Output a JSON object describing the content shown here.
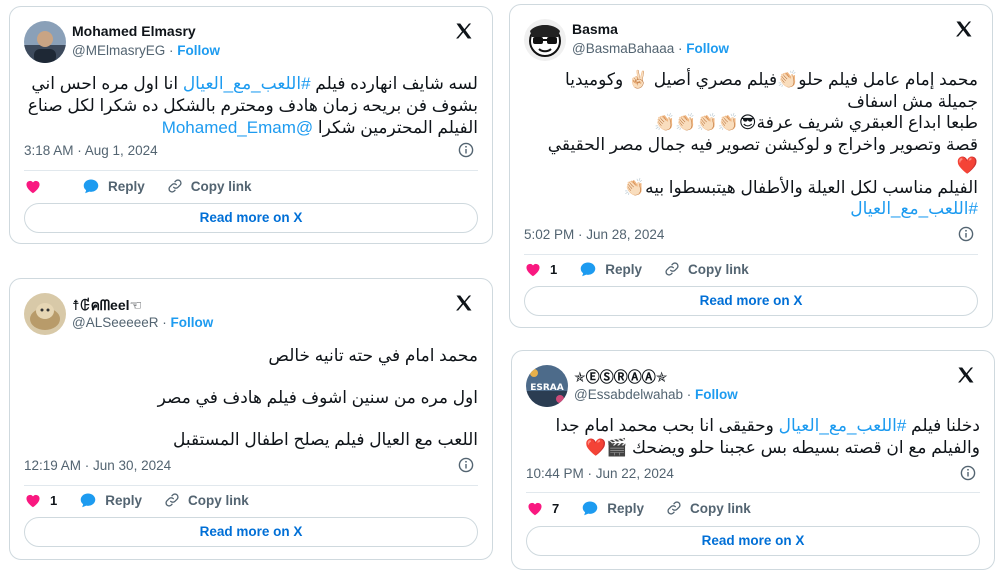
{
  "brand": {
    "blue": "#1d9bf0",
    "heart": "#f91880",
    "text": "#0f1419",
    "muted": "#536471"
  },
  "tweets": [
    {
      "name": "Mohamed Elmasry",
      "handle": "@MElmasryEG",
      "dot": " · ",
      "follow": "Follow",
      "lines": [
        [
          "لسه شايف انهارده فيلم ",
          "#اللعب_مع_العيال",
          " انا اول مره احس اني"
        ],
        [
          "بشوف فن بريحه زمان هادف ومحترم بالشكل ده شكرا لكل صناع"
        ],
        [
          "الفيلم المحترمين شكرا ",
          "@Mohamed_Emam",
          ""
        ]
      ],
      "time": "3:18 AM · Aug 1, 2024",
      "like_count": "",
      "reply": "Reply",
      "copy": "Copy link",
      "readmore": "Read more on X",
      "avatar_icon": "person-photo-icon"
    },
    {
      "name": "Basma",
      "handle": "@BasmaBahaaa",
      "dot": " · ",
      "follow": "Follow",
      "lines": [
        [
          "محمد إمام عامل فيلم حلو👏🏻فيلم مصري أصيل ✌🏻 وكوميديا"
        ],
        [
          "جميلة مش اسفاف"
        ],
        [
          "طبعا ابداع العبقري شريف عرفة😎👏🏻👏🏻👏🏻👏🏻"
        ],
        [
          "قصة وتصوير واخراج و لوكيشن تصوير فيه جمال مصر الحقيقي"
        ],
        [
          "❤️"
        ],
        [
          "الفيلم مناسب لكل العيلة والأطفال هيتبسطوا بيه👏🏻"
        ],
        [
          "",
          "#اللعب_مع_العيال",
          ""
        ]
      ],
      "time": "5:02 PM · Jun 28, 2024",
      "like_count": "1",
      "reply": "Reply",
      "copy": "Copy link",
      "readmore": "Read more on X",
      "avatar_icon": "sunglasses-cartoon-icon"
    },
    {
      "name": "☨ꂅคᗰeel☜",
      "handle": "@ALSeeeeeR",
      "dot": " · ",
      "follow": "Follow",
      "lines": [
        [
          "محمد امام في حته تانيه خالص"
        ],
        [
          "اول مره من سنين اشوف فيلم هادف في مصر"
        ],
        [
          "اللعب مع العيال فيلم يصلح اطفال المستقبل"
        ]
      ],
      "time": "12:19 AM · Jun 30, 2024",
      "like_count": "1",
      "reply": "Reply",
      "copy": "Copy link",
      "readmore": "Read more on X",
      "avatar_icon": "animal-photo-icon"
    },
    {
      "name": "✯ⒺⓈⓇⒶⒶ✯",
      "handle": "@Essabdelwahab",
      "dot": " · ",
      "follow": "Follow",
      "lines": [
        [
          "دخلنا فيلم ",
          "#اللعب_مع_العيال",
          " وحقيقى انا بحب محمد امام جدا"
        ],
        [
          "والفيلم مع ان قصته بسيطه بس عجبنا حلو ويضحك 🎬❤️"
        ]
      ],
      "time": "10:44 PM · Jun 22, 2024",
      "like_count": "7",
      "reply": "Reply",
      "copy": "Copy link",
      "readmore": "Read more on X",
      "avatar_icon": "esraa-logo-icon",
      "avatar_text": "ESRAA"
    }
  ]
}
